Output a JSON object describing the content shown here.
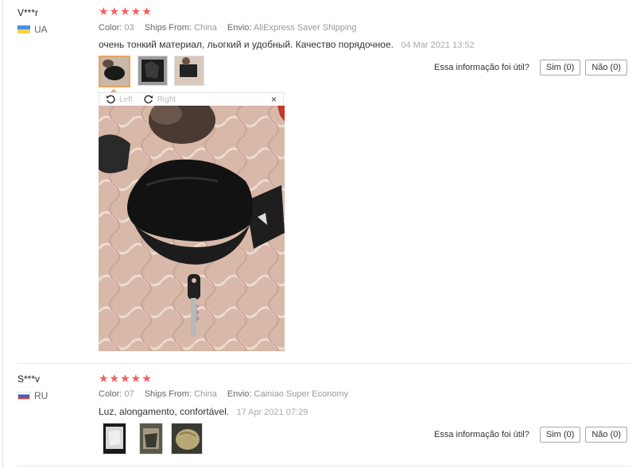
{
  "reviews": [
    {
      "user": "V***r",
      "country": "UA",
      "rating_stars": 5,
      "stars": "★★★★★",
      "color_label": "Color:",
      "color_value": "03",
      "ships_label": "Ships From:",
      "ships_value": "China",
      "envio_label": "Envio:",
      "envio_value": "AliExpress Saver Shipping",
      "comment": "очень тонкий материал, льогкий и удобный. Качество порядочное.",
      "date": "04 Mar 2021 13:52",
      "helpful_question": "Essa informação foi útil?",
      "yes_label": "Sim (0)",
      "no_label": "Não (0)",
      "viewer": {
        "left_label": "Left",
        "right_label": "Right",
        "close_label": "×"
      }
    },
    {
      "user": "S***v",
      "country": "RU",
      "rating_stars": 5,
      "stars": "★★★★★",
      "color_label": "Color:",
      "color_value": "07",
      "ships_label": "Ships From:",
      "ships_value": "China",
      "envio_label": "Envio:",
      "envio_value": "Cainiao Super Economy",
      "comment": "Luz, alongamento, confortável.",
      "date": "17 Apr 2021 07:29",
      "helpful_question": "Essa informação foi útil?",
      "yes_label": "Sim (0)",
      "no_label": "Não (0)"
    }
  ],
  "colors": {
    "star": "#f45e5e",
    "active_thumb_border": "#e9a25f"
  }
}
